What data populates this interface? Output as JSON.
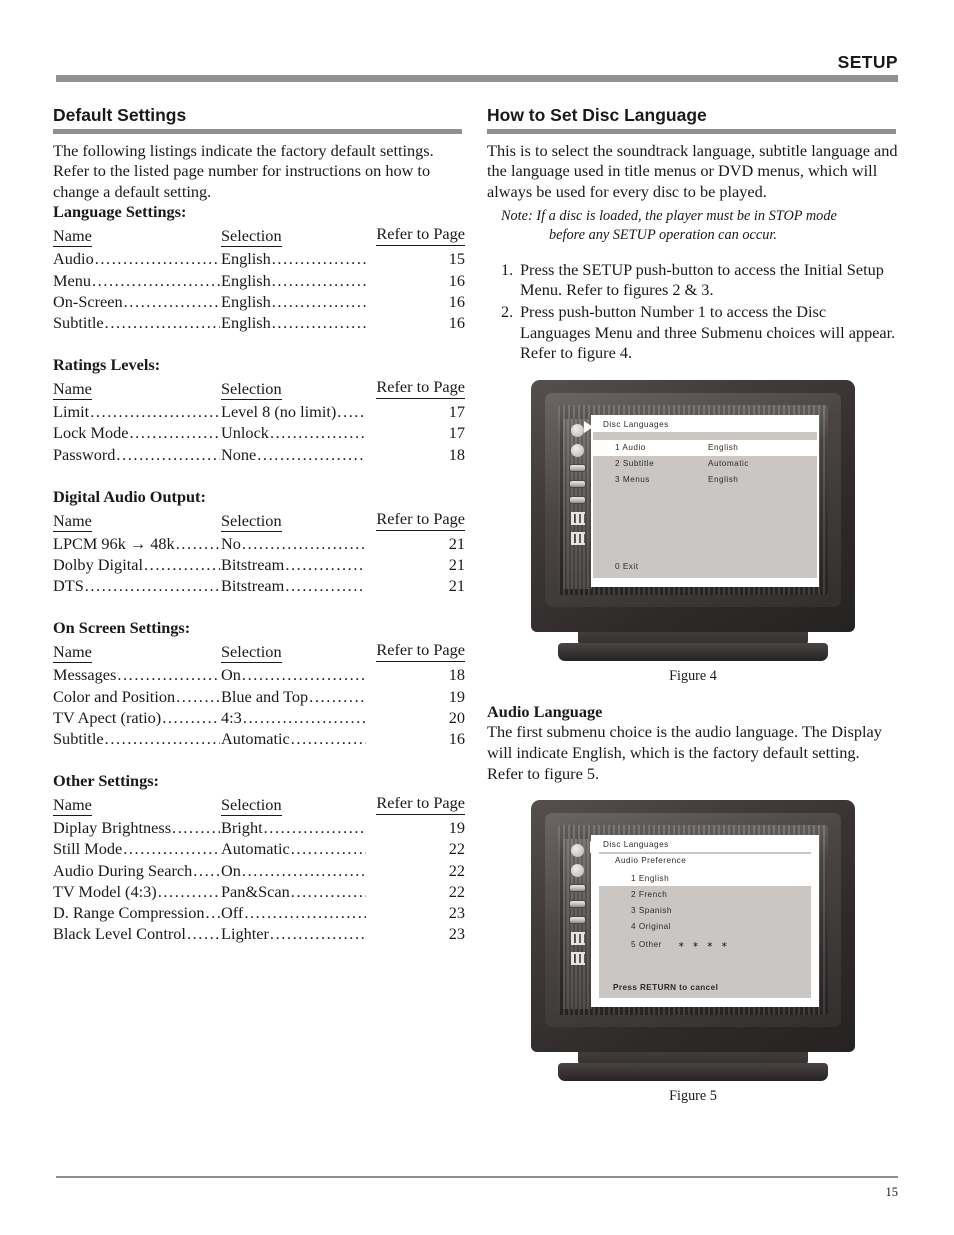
{
  "header": {
    "title": "SETUP"
  },
  "footer": {
    "page_number": "15"
  },
  "left": {
    "heading": "Default Settings",
    "intro": "The following listings indicate the factory default settings. Refer to the listed page number for instructions on how to change a default setting.",
    "columns": {
      "name": "Name",
      "selection": "Selection",
      "page": "Refer to Page"
    },
    "tables": [
      {
        "title": "Language Settings:",
        "rows": [
          {
            "name": "Audio",
            "selection": "English",
            "page": "15"
          },
          {
            "name": "Menu",
            "selection": "English",
            "page": "16"
          },
          {
            "name": "On-Screen",
            "selection": "English",
            "page": "16"
          },
          {
            "name": "Subtitle",
            "selection": "English",
            "page": "16"
          }
        ]
      },
      {
        "title": "Ratings Levels:",
        "rows": [
          {
            "name": "Limit",
            "selection": "Level 8 (no limit)",
            "page": "17"
          },
          {
            "name": "Lock Mode",
            "selection": "Unlock",
            "page": "17"
          },
          {
            "name": "Password",
            "selection": "None",
            "page": "18"
          }
        ]
      },
      {
        "title": "Digital Audio Output:",
        "rows": [
          {
            "name": "LPCM 96k → 48k",
            "selection": "No",
            "page": "21"
          },
          {
            "name": "Dolby Digital",
            "selection": "Bitstream",
            "page": "21"
          },
          {
            "name": "DTS",
            "selection": "Bitstream",
            "page": "21"
          }
        ]
      },
      {
        "title": "On Screen Settings:",
        "rows": [
          {
            "name": "Messages",
            "selection": "On",
            "page": "18"
          },
          {
            "name": "Color and Position",
            "selection": "Blue and Top",
            "page": "19"
          },
          {
            "name": "TV Apect (ratio)",
            "selection": "4:3",
            "page": "20"
          },
          {
            "name": "Subtitle",
            "selection": "Automatic",
            "page": "16"
          }
        ]
      },
      {
        "title": "Other Settings:",
        "rows": [
          {
            "name": "Diplay Brightness",
            "selection": "Bright",
            "page": "19"
          },
          {
            "name": "Still Mode",
            "selection": "Automatic",
            "page": "22"
          },
          {
            "name": "Audio During Search",
            "selection": "On",
            "page": "22"
          },
          {
            "name": "TV Model (4:3)",
            "selection": "Pan&Scan",
            "page": "22"
          },
          {
            "name": "D. Range Compression",
            "selection": "Off",
            "page": "23"
          },
          {
            "name": "Black Level Control",
            "selection": "Lighter",
            "page": "23"
          }
        ]
      }
    ]
  },
  "right": {
    "heading": "How to Set Disc Language",
    "intro": "This is to select the soundtrack language, subtitle language and the language used in title menus or DVD menus, which will always be used for every disc to be played.",
    "note_line1": "Note: If a disc is loaded, the player must be in STOP mode",
    "note_line2": "before any SETUP operation can occur.",
    "steps": [
      {
        "num": "1.",
        "text": "Press the SETUP push-button to access the Initial Setup Menu. Refer to figures 2 & 3."
      },
      {
        "num": "2.",
        "text": "Press push-button Number 1 to access the Disc Languages Menu and three Submenu choices will appear. Refer to figure 4."
      }
    ],
    "figure4": {
      "caption": "Figure 4",
      "osd_title": "Disc Languages",
      "rows": [
        {
          "key": "1 Audio",
          "value": "English",
          "selected": true
        },
        {
          "key": "2 Subtitle",
          "value": "Automatic",
          "selected": false
        },
        {
          "key": "3 Menus",
          "value": "English",
          "selected": false
        }
      ],
      "exit": "0 Exit"
    },
    "audio_language": {
      "heading": "Audio Language",
      "text": "The first submenu choice is the audio language. The Display will indicate English, which is the factory default setting. Refer to figure 5."
    },
    "figure5": {
      "caption": "Figure 5",
      "osd_title": "Disc Languages",
      "sub_title": "Audio Preference",
      "options": [
        {
          "label": "1 English",
          "stars": "",
          "selected": true
        },
        {
          "label": "2 French",
          "stars": "",
          "selected": false
        },
        {
          "label": "3 Spanish",
          "stars": "",
          "selected": false
        },
        {
          "label": "4 Original",
          "stars": "",
          "selected": false
        },
        {
          "label": "5 Other",
          "stars": "∗ ∗ ∗ ∗",
          "selected": false
        }
      ],
      "footer": "Press RETURN to cancel"
    }
  }
}
